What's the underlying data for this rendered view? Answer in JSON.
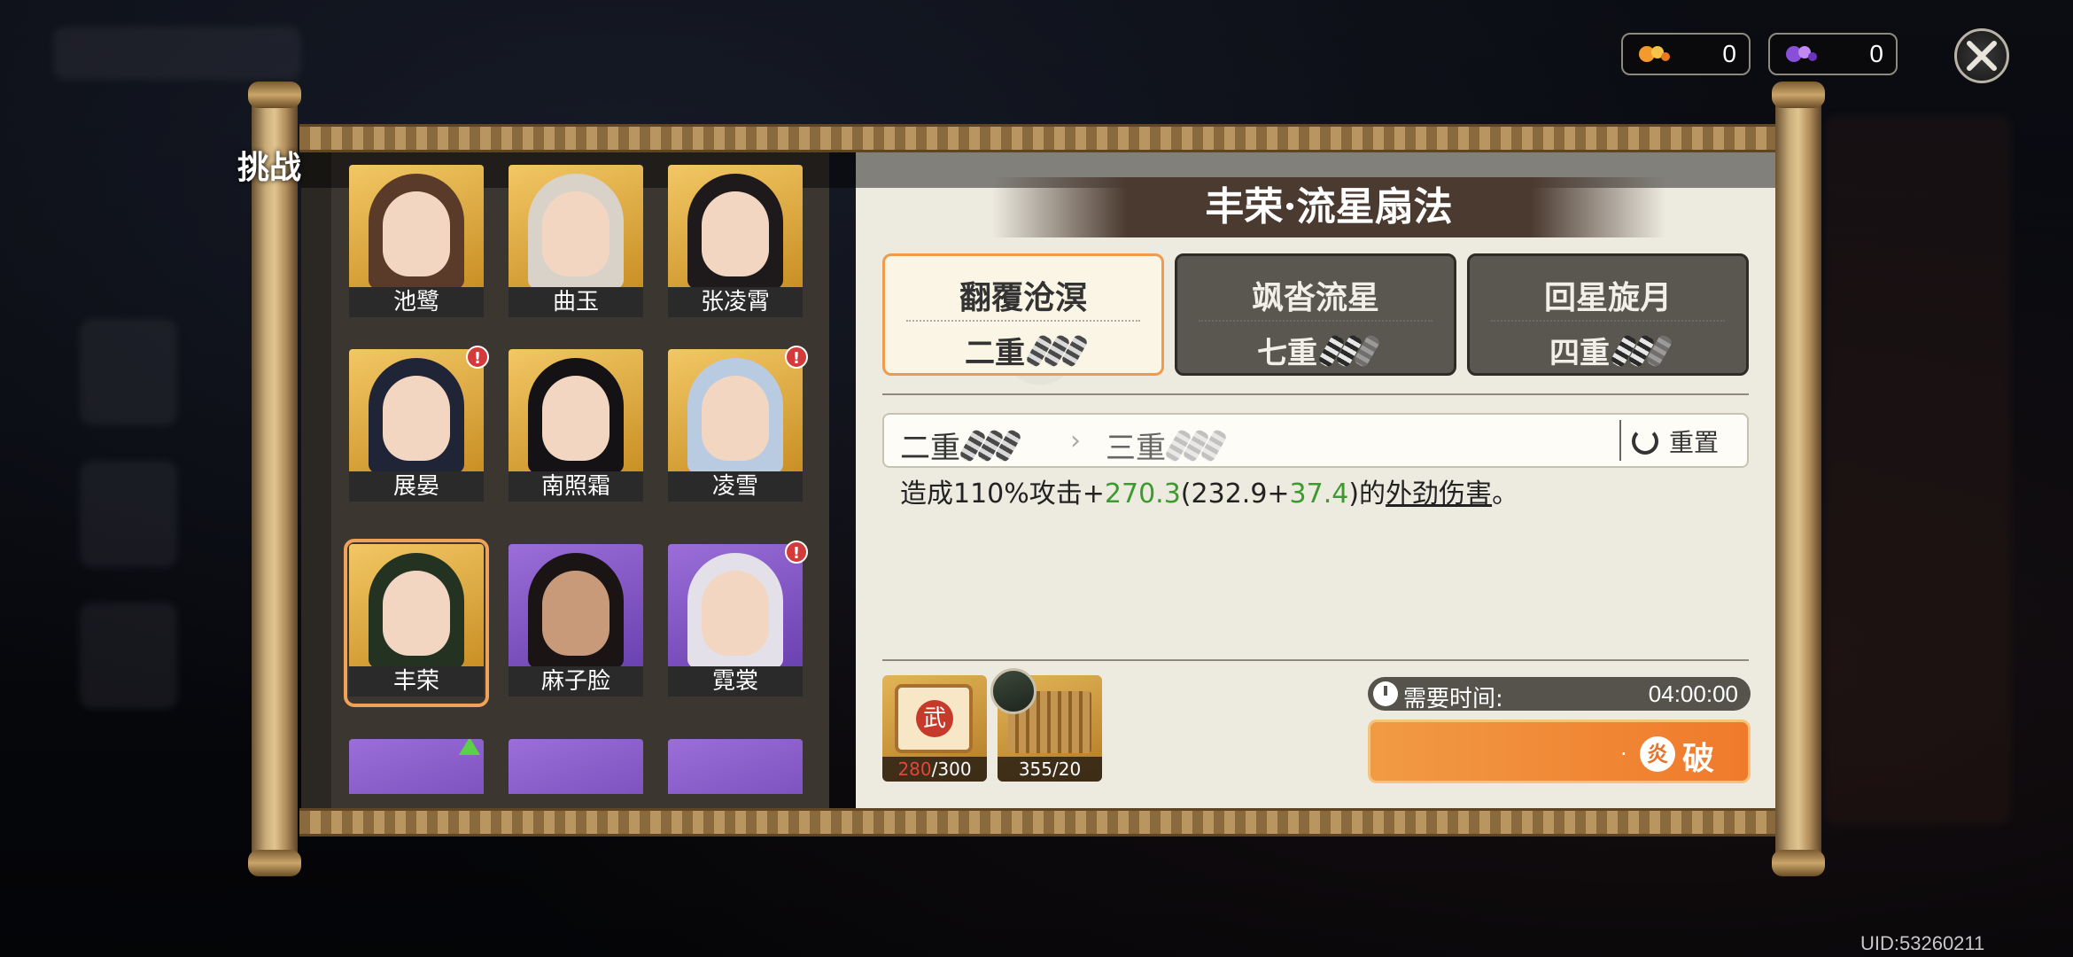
{
  "currencies": [
    {
      "icon": "orange-gem-icon",
      "value": "0"
    },
    {
      "icon": "purple-gem-icon",
      "value": "0"
    }
  ],
  "challenge_label": "挑战",
  "heroes": [
    {
      "name": "池鹭",
      "tier": "gold",
      "alert": false
    },
    {
      "name": "曲玉",
      "tier": "gold",
      "alert": false
    },
    {
      "name": "张凌霄",
      "tier": "gold",
      "alert": false
    },
    {
      "name": "展晏",
      "tier": "gold",
      "alert": true
    },
    {
      "name": "南照霜",
      "tier": "gold",
      "alert": false
    },
    {
      "name": "凌雪",
      "tier": "gold",
      "alert": true
    },
    {
      "name": "丰荣",
      "tier": "gold",
      "alert": false,
      "selected": true
    },
    {
      "name": "麻子脸",
      "tier": "purple",
      "alert": false
    },
    {
      "name": "霓裳",
      "tier": "purple",
      "alert": true
    }
  ],
  "skill": {
    "title": "丰荣·流星扇法",
    "tabs": [
      {
        "name": "翻覆沧溟",
        "level": "二重",
        "filled": 3,
        "total": 3,
        "active": true
      },
      {
        "name": "飒沓流星",
        "level": "七重",
        "filled": 2,
        "total": 3,
        "active": false
      },
      {
        "name": "回星旋月",
        "level": "四重",
        "filled": 2,
        "total": 3,
        "active": false
      }
    ],
    "upgrade": {
      "current": "二重",
      "next": "三重",
      "reset_label": "重置"
    },
    "description": {
      "prefix": "造成110%攻击+",
      "value": "270.3",
      "open_paren": "(",
      "base": "232.9+",
      "bonus": "37.4",
      "close_paren": ")的",
      "damage_type": "外劲伤害",
      "suffix": "。"
    }
  },
  "costs": [
    {
      "icon": "martial-scroll-icon",
      "have": "280",
      "need": "/300",
      "insufficient": true
    },
    {
      "icon": "bamboo-slip-icon",
      "have": "355",
      "need": "/20",
      "insufficient": false
    }
  ],
  "time_label": "需要时间:",
  "time_value": "04:00:00",
  "break_label": "破",
  "break_seal": "炎",
  "break_dot": "·",
  "uid": "UID:53260211"
}
